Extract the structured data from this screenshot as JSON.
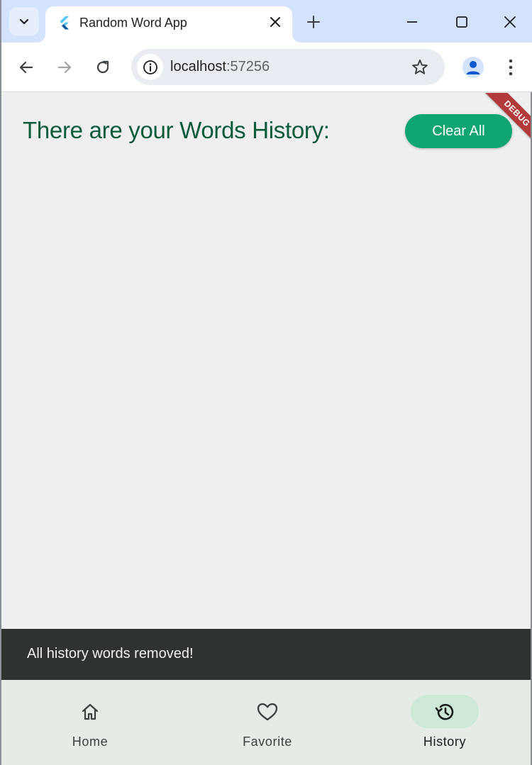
{
  "browser": {
    "tab_title": "Random Word App",
    "url_host": "localhost",
    "url_port": ":57256"
  },
  "app": {
    "heading": "There are your Words History:",
    "clear_button_label": "Clear All",
    "debug_banner": "DEBUG",
    "snackbar_message": "All history words removed!",
    "nav": {
      "items": [
        {
          "label": "Home",
          "icon": "home-icon"
        },
        {
          "label": "Favorite",
          "icon": "heart-icon"
        },
        {
          "label": "History",
          "icon": "history-icon",
          "active": true
        }
      ]
    },
    "colors": {
      "heading": "#0b5b3a",
      "button": "#0ea571",
      "snackbar": "#2e3330",
      "nav_active": "#cde8d7"
    }
  }
}
